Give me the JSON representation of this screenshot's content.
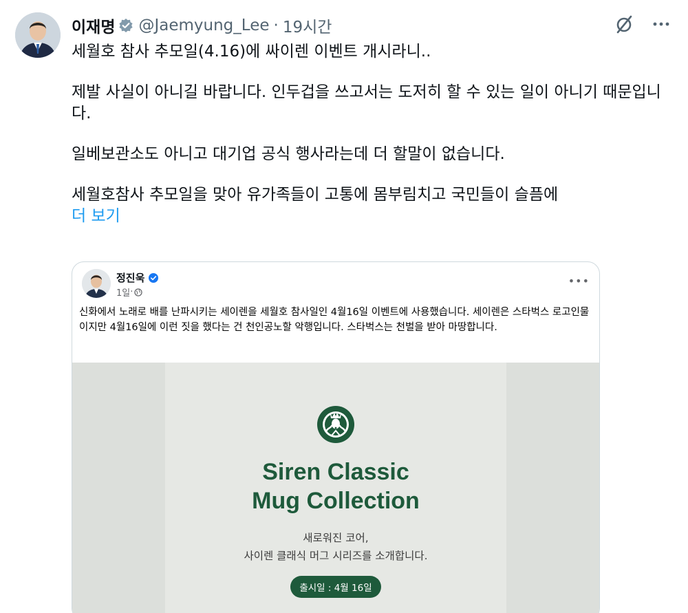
{
  "author": {
    "display_name": "이재명",
    "handle": "@Jaemyung_Lee",
    "separator": "·",
    "time": "19시간",
    "avatar_icon": "profile-photo",
    "verified_color": "#829aab"
  },
  "actions": {
    "grok_icon": "slashed-circle-icon",
    "more_label": "···"
  },
  "tweet": {
    "lines": [
      "세월호 참사 추모일(4.16)에 싸이렌 이벤트 개시라니..",
      "제발 사실이 아니길 바랍니다. 인두겁을 쓰고서는 도저히 할 수 있는 일이 아니기 때문입니다.",
      "일베보관소도 아니고 대기업 공식 행사라는데 더 할말이 없습니다.",
      "세월호참사 추모일을 맞아 유가족들이 고통에 몸부림치고 국민들이 슬픔에"
    ],
    "show_more": "더 보기",
    "link_color": "#1d9bf0"
  },
  "embedded_post": {
    "author_name": "정진욱",
    "meta_time": "1일",
    "meta_separator": "·",
    "more_label": "•••",
    "text": "신화에서 노래로 배를 난파시키는 세이렌을 세월호 참사일인 4월16일 이벤트에 사용했습니다. 세이렌은 스타벅스 로고인물이지만 4월16일에 이런 짓을 했다는 건 천인공노할 악행입니다. 스타벅스는 천벌을 받아 마땅합니다.",
    "promo": {
      "title_line1": "Siren Classic",
      "title_line2": "Mug Collection",
      "sub_line1": "새로워진 코어,",
      "sub_line2": "사이렌 클래식 머그 시리즈를 소개합니다.",
      "badge": "출시일 : 4월 16일",
      "brand_color": "#1e5a3b"
    }
  }
}
